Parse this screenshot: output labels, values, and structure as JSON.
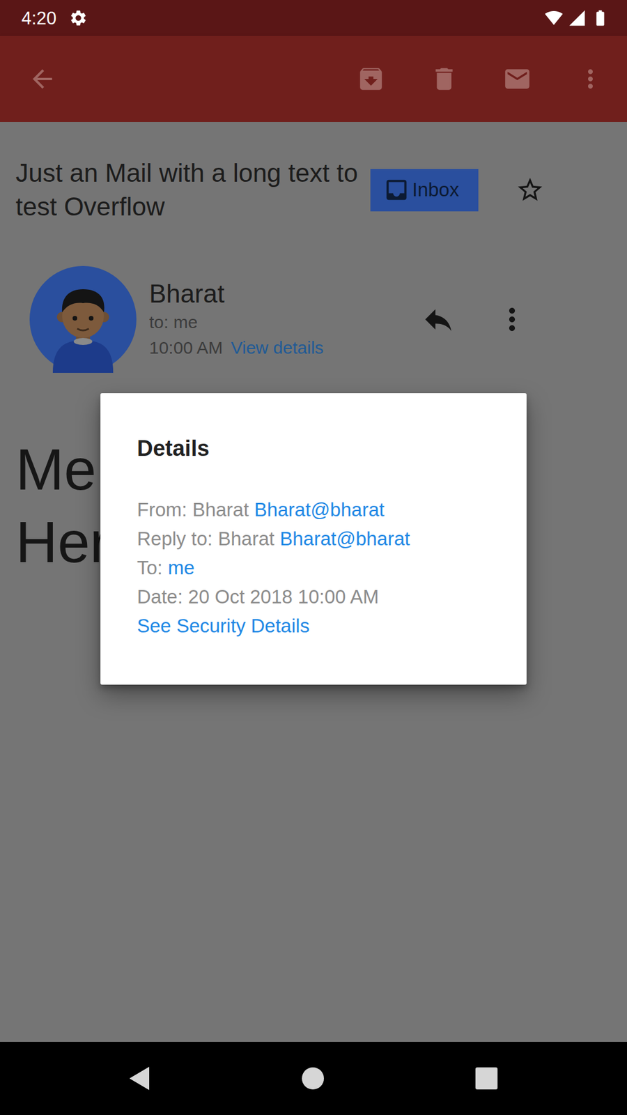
{
  "status_bar": {
    "time": "4:20"
  },
  "email": {
    "subject": "Just an Mail with a long text to test Overflow",
    "label": "Inbox",
    "starred": false,
    "sender": "Bharat",
    "recipient_line": "to: me",
    "time": "10:00 AM",
    "details_link": "View details",
    "body_lines": [
      "Me",
      "Her"
    ]
  },
  "dialog": {
    "title": "Details",
    "rows": [
      {
        "label": "From:",
        "name": "Bharat",
        "value": "Bharat@bharat",
        "kind": "link"
      },
      {
        "label": "Reply to:",
        "name": "Bharat",
        "value": "Bharat@bharat",
        "kind": "link"
      },
      {
        "label": "To:",
        "value": "me",
        "kind": "link"
      },
      {
        "label": "Date:",
        "value": "20 Oct 2018 10:00 AM",
        "kind": "text"
      }
    ],
    "security_link": "See Security Details"
  }
}
